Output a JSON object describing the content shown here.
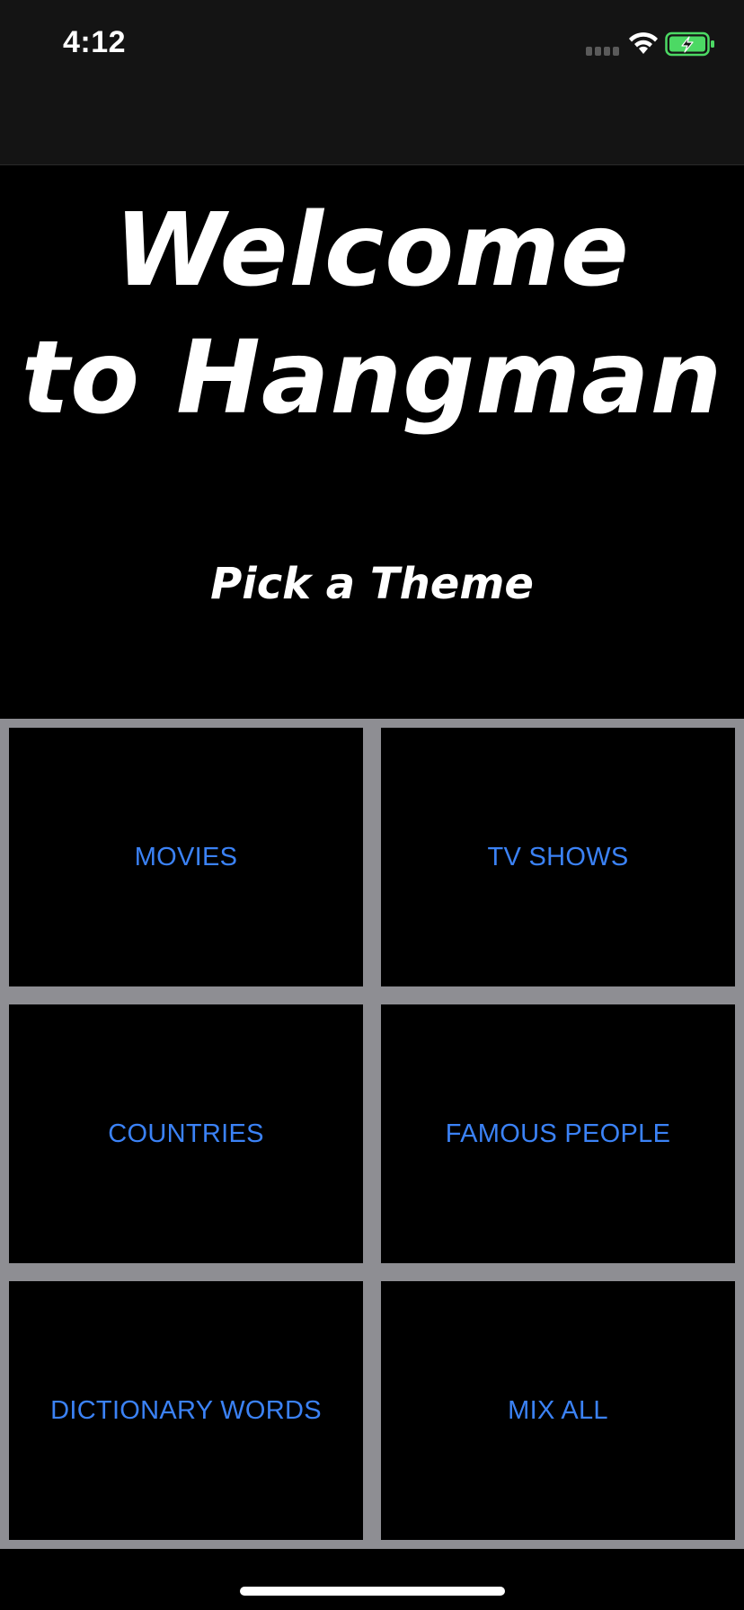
{
  "status_bar": {
    "time": "4:12"
  },
  "header": {
    "title_line1": "Welcome",
    "title_line2": "to Hangman",
    "subtitle": "Pick a Theme"
  },
  "themes": [
    {
      "label": "MOVIES"
    },
    {
      "label": "TV SHOWS"
    },
    {
      "label": "COUNTRIES"
    },
    {
      "label": "FAMOUS PEOPLE"
    },
    {
      "label": "DICTIONARY WORDS"
    },
    {
      "label": "MIX ALL"
    }
  ],
  "colors": {
    "background": "#000000",
    "status_bar": "#141414",
    "grid_border": "#8e8e93",
    "button_text": "#3b82f6",
    "battery_green": "#4cd964"
  },
  "icons": {
    "signal": "signal-bars-icon",
    "wifi": "wifi-icon",
    "battery": "battery-charging-icon"
  }
}
